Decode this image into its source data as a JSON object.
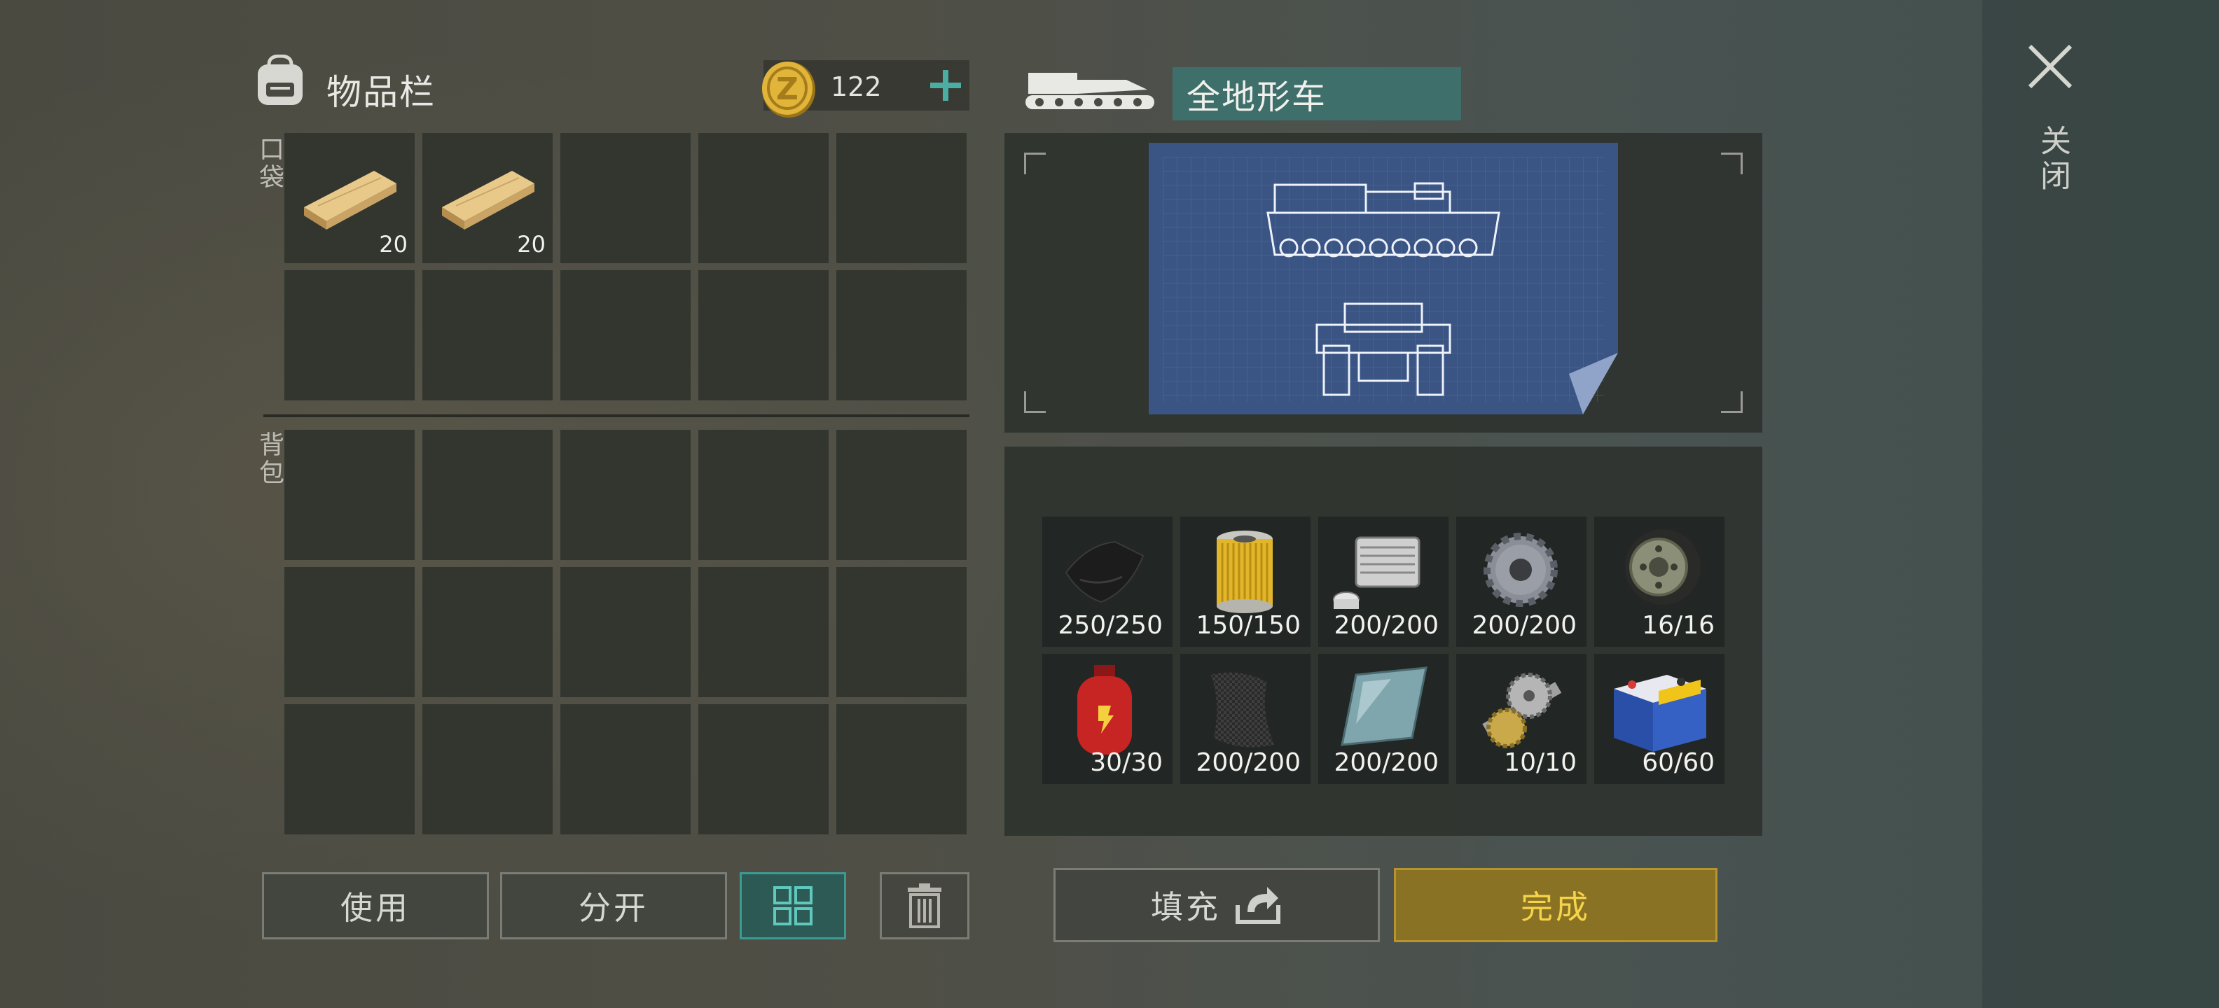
{
  "inventory": {
    "title": "物品栏",
    "coins": "122",
    "pocket_label": "口袋",
    "backpack_label": "背包",
    "pocket_slots": [
      {
        "item": "wooden-plank",
        "qty": "20"
      },
      {
        "item": "wooden-plank",
        "qty": "20"
      },
      {
        "item": "",
        "qty": ""
      },
      {
        "item": "",
        "qty": ""
      },
      {
        "item": "",
        "qty": ""
      },
      {
        "item": "",
        "qty": ""
      },
      {
        "item": "",
        "qty": ""
      },
      {
        "item": "",
        "qty": ""
      },
      {
        "item": "",
        "qty": ""
      },
      {
        "item": "",
        "qty": ""
      }
    ]
  },
  "buttons": {
    "use": "使用",
    "split": "分开",
    "fill": "填充",
    "done": "完成"
  },
  "vehicle": {
    "name": "全地形车",
    "materials": [
      {
        "icon": "rubber-sheet-icon",
        "qty": "250/250"
      },
      {
        "icon": "air-filter-icon",
        "qty": "150/150"
      },
      {
        "icon": "engine-cylinder-icon",
        "qty": "200/200"
      },
      {
        "icon": "gear-icon",
        "qty": "200/200"
      },
      {
        "icon": "wheel-hub-icon",
        "qty": "16/16"
      },
      {
        "icon": "gas-canister-icon",
        "qty": "30/30"
      },
      {
        "icon": "carbon-fabric-icon",
        "qty": "200/200"
      },
      {
        "icon": "metal-plate-icon",
        "qty": "200/200"
      },
      {
        "icon": "transmission-shaft-icon",
        "qty": "10/10"
      },
      {
        "icon": "car-battery-icon",
        "qty": "60/60"
      }
    ]
  },
  "close_label": "关闭",
  "colors": {
    "accent_teal": "#3e6f6b",
    "done_gold": "#8a7224",
    "done_text": "#f5d34a"
  }
}
